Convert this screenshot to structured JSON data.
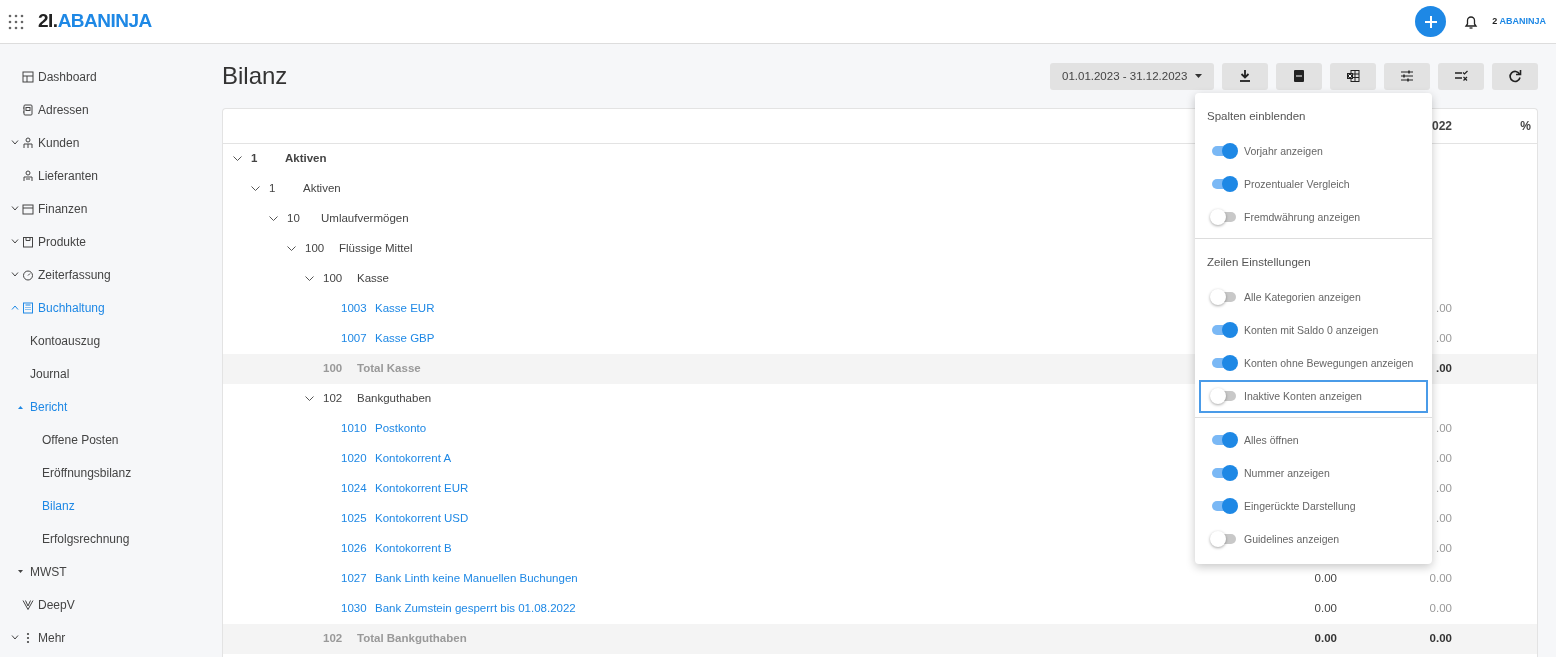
{
  "header": {
    "logo": {
      "prefix": "2I.",
      "name": "ABANINJA"
    },
    "account_logo": {
      "prefix": "2",
      "name": "ABANINJA"
    }
  },
  "sidebar": {
    "items": [
      {
        "label": "Dashboard",
        "kind": "link",
        "selected": false
      },
      {
        "label": "Adressen",
        "kind": "link",
        "selected": false
      },
      {
        "label": "Kunden",
        "kind": "group",
        "expanded": false,
        "selected": false
      },
      {
        "label": "Lieferanten",
        "kind": "link",
        "selected": false
      },
      {
        "label": "Finanzen",
        "kind": "group",
        "expanded": false,
        "selected": false
      },
      {
        "label": "Produkte",
        "kind": "group",
        "expanded": false,
        "selected": false
      },
      {
        "label": "Zeiterfassung",
        "kind": "group",
        "expanded": false,
        "selected": false
      },
      {
        "label": "Buchhaltung",
        "kind": "group",
        "expanded": true,
        "selected": true,
        "children": [
          {
            "label": "Kontoauszug",
            "kind": "link",
            "selected": false
          },
          {
            "label": "Journal",
            "kind": "link",
            "selected": false
          },
          {
            "label": "Bericht",
            "kind": "group",
            "expanded": true,
            "selected": true,
            "children": [
              {
                "label": "Offene Posten",
                "kind": "link",
                "selected": false
              },
              {
                "label": "Eröffnungsbilanz",
                "kind": "link",
                "selected": false
              },
              {
                "label": "Bilanz",
                "kind": "link",
                "selected": true
              },
              {
                "label": "Erfolgsrechnung",
                "kind": "link",
                "selected": false
              }
            ]
          },
          {
            "label": "MWST",
            "kind": "group",
            "expanded": false,
            "selected": false
          }
        ]
      },
      {
        "label": "DeepV",
        "kind": "link",
        "selected": false
      },
      {
        "label": "Mehr",
        "kind": "group",
        "expanded": false,
        "selected": false
      }
    ]
  },
  "page": {
    "title": "Bilanz",
    "date_range": "01.01.2023 - 31.12.2023"
  },
  "settings_menu": {
    "sections": [
      {
        "title": "Spalten einblenden",
        "items": [
          {
            "label": "Vorjahr anzeigen",
            "on": true,
            "focused": false
          },
          {
            "label": "Prozentualer Vergleich",
            "on": true,
            "focused": false
          },
          {
            "label": "Fremdwährung anzeigen",
            "on": false,
            "focused": false
          }
        ]
      },
      {
        "title": "Zeilen Einstellungen",
        "items": [
          {
            "label": "Alle Kategorien anzeigen",
            "on": false,
            "focused": false
          },
          {
            "label": "Konten mit Saldo 0 anzeigen",
            "on": true,
            "focused": false
          },
          {
            "label": "Konten ohne Bewegungen anzeigen",
            "on": true,
            "focused": false
          },
          {
            "label": "Inaktive Konten anzeigen",
            "on": false,
            "focused": true
          }
        ]
      },
      {
        "items": [
          {
            "label": "Alles öffnen",
            "on": true,
            "focused": false
          },
          {
            "label": "Nummer anzeigen",
            "on": true,
            "focused": false
          },
          {
            "label": "Eingerückte Darstellung",
            "on": true,
            "focused": false
          },
          {
            "label": "Guidelines anzeigen",
            "on": false,
            "focused": false
          }
        ]
      }
    ]
  },
  "table": {
    "header": {
      "column_2": "022",
      "column_3": "%"
    },
    "rows": [
      {
        "kind": "group",
        "number": "1",
        "label": "Aktiven",
        "expanded": true,
        "children": [
          {
            "kind": "group",
            "number": "1",
            "label": "Aktiven",
            "expanded": true,
            "children": [
              {
                "kind": "group",
                "number": "10",
                "label": "Umlaufvermögen",
                "expanded": true,
                "children": [
                  {
                    "kind": "group",
                    "number": "100",
                    "label": "Flüssige Mittel",
                    "expanded": true,
                    "children": [
                      {
                        "kind": "group",
                        "number": "100",
                        "label": "Kasse",
                        "expanded": true,
                        "children": [
                          {
                            "kind": "account",
                            "number": "1003",
                            "label": "Kasse EUR",
                            "column_2": ".00"
                          },
                          {
                            "kind": "account",
                            "number": "1007",
                            "label": "Kasse GBP",
                            "column_2": ".00"
                          }
                        ]
                      },
                      {
                        "kind": "total",
                        "number": "100",
                        "label": "Total Kasse",
                        "column_2": ".00"
                      },
                      {
                        "kind": "group",
                        "number": "102",
                        "label": "Bankguthaben",
                        "expanded": true,
                        "children": [
                          {
                            "kind": "account",
                            "number": "1010",
                            "label": "Postkonto",
                            "column_2": ".00"
                          },
                          {
                            "kind": "account",
                            "number": "1020",
                            "label": "Kontokorrent A",
                            "column_2": ".00"
                          },
                          {
                            "kind": "account",
                            "number": "1024",
                            "label": "Kontokorrent EUR",
                            "column_2": ".00"
                          },
                          {
                            "kind": "account",
                            "number": "1025",
                            "label": "Kontokorrent USD",
                            "column_2": ".00"
                          },
                          {
                            "kind": "account",
                            "number": "1026",
                            "label": "Kontokorrent B",
                            "column_2": ".00"
                          },
                          {
                            "kind": "account",
                            "number": "1027",
                            "label": "Bank Linth keine Manuellen Buchungen",
                            "column_1": "0.00",
                            "column_2": "0.00"
                          },
                          {
                            "kind": "account",
                            "number": "1030",
                            "label": "Bank Zumstein gesperrt bis 01.08.2022",
                            "column_1": "0.00",
                            "column_2": "0.00"
                          }
                        ]
                      },
                      {
                        "kind": "total",
                        "number": "102",
                        "label": "Total Bankguthaben",
                        "column_1": "0.00",
                        "column_2": "0.00"
                      }
                    ]
                  }
                ]
              }
            ]
          }
        ]
      }
    ]
  }
}
